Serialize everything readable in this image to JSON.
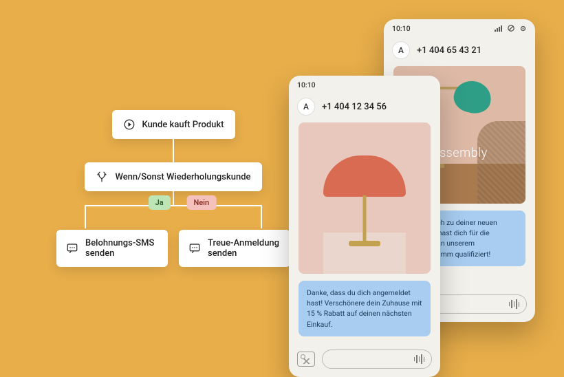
{
  "flow": {
    "trigger": {
      "label": "Kunde kauft Produkt"
    },
    "condition": {
      "label": "Wenn/Sonst Wiederholungskunde",
      "yes": "Ja",
      "no": "Nein"
    },
    "branch_yes": {
      "label": "Belohnungs-SMS senden"
    },
    "branch_no": {
      "label": "Treue-Anmeldung senden"
    }
  },
  "phone_front": {
    "time": "10:10",
    "avatar_initial": "A",
    "number": "+1 404 12 34 56",
    "message": "Danke, dass du dich angemeldet hast! Verschönere dein Zuhause mit 15 % Rabatt auf deinen nächsten Einkauf."
  },
  "phone_back": {
    "time": "10:10",
    "avatar_initial": "A",
    "number": "+1 404 65 43 21",
    "image_caption": "Assembly",
    "message": "Glückwunsch zu deiner neuen Lampe. Du hast dich für die Teilnahme an unserem Treueprogramm qualifiziert!"
  }
}
